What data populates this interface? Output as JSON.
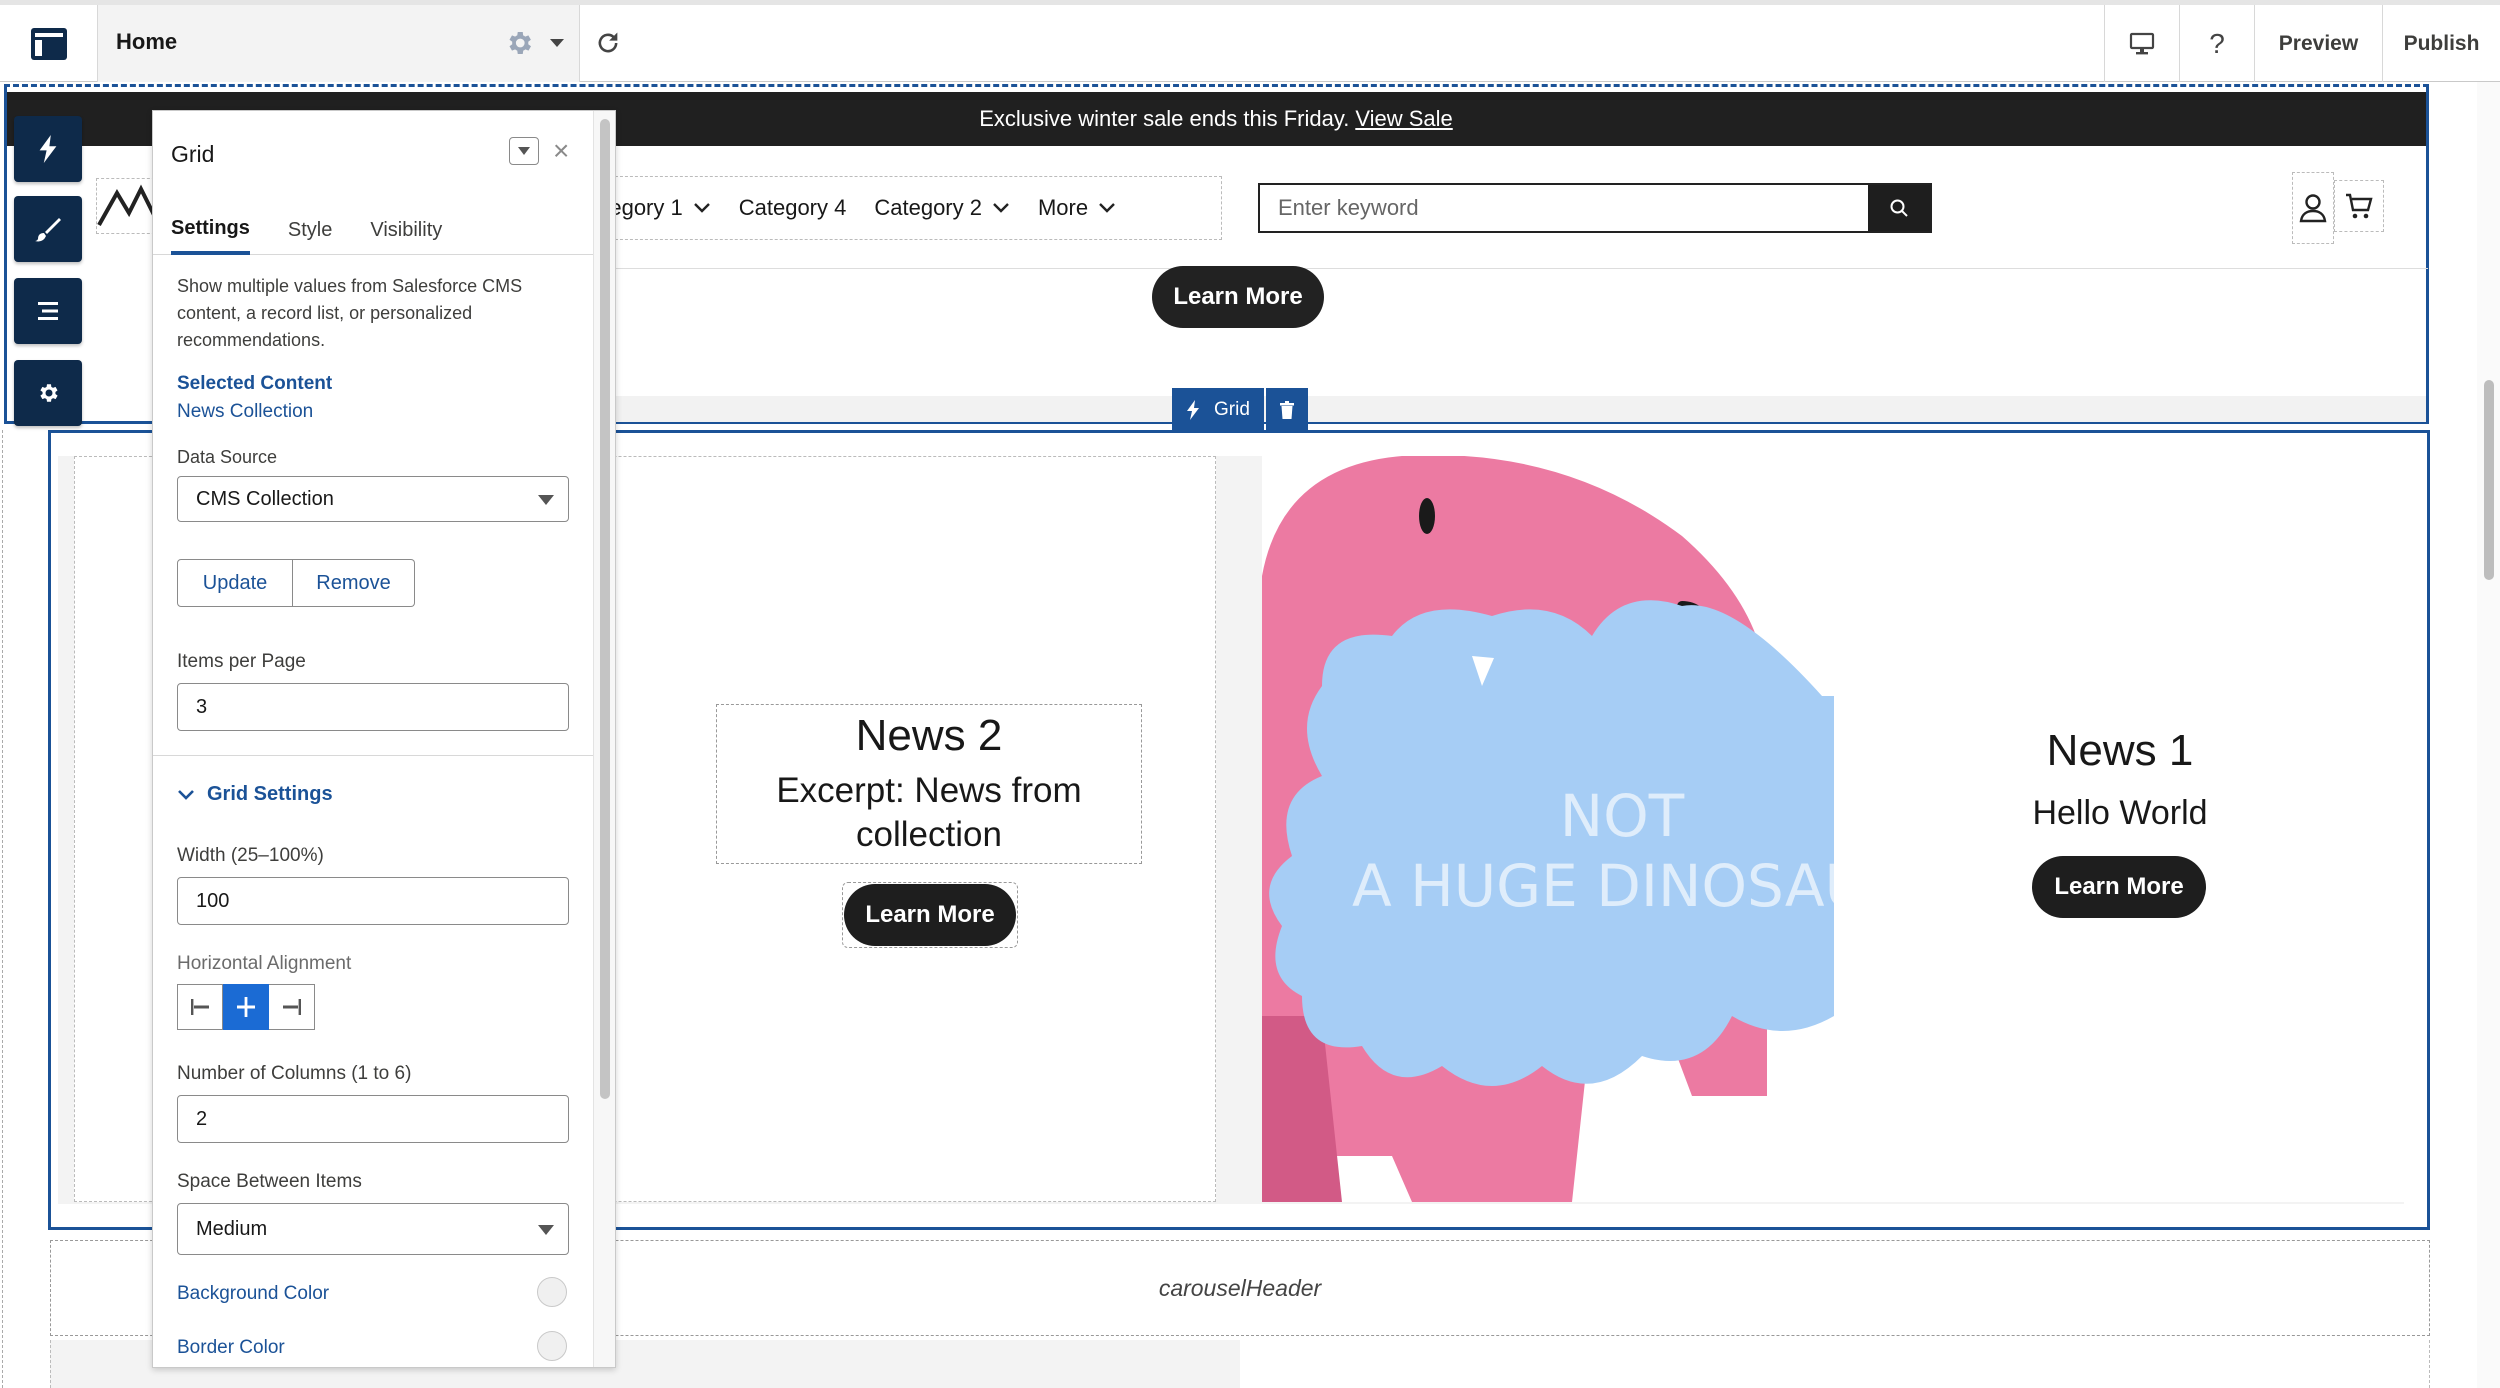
{
  "topbar": {
    "page_name": "Home",
    "preview_label": "Preview",
    "publish_label": "Publish",
    "help_label": "?"
  },
  "site": {
    "announcement_text": "Exclusive winter sale ends this Friday.",
    "announcement_link": "View Sale",
    "nav_items": [
      {
        "label": "ategory 1",
        "has_chevron": true
      },
      {
        "label": "Category 4",
        "has_chevron": false
      },
      {
        "label": "Category 2",
        "has_chevron": true
      },
      {
        "label": "More",
        "has_chevron": true
      }
    ],
    "search_placeholder": "Enter keyword",
    "header_learn_more": "Learn More",
    "grid_chip_label": "Grid",
    "news2": {
      "title": "News 2",
      "excerpt": "Excerpt: News from collection",
      "button": "Learn More"
    },
    "news1": {
      "title": "News 1",
      "excerpt": "Hello World",
      "button": "Learn More",
      "image_text_line1": "NOT",
      "image_text_line2": "A HUGE DINOSAU"
    },
    "carousel_header": "carouselHeader"
  },
  "panel": {
    "title": "Grid",
    "tabs": [
      "Settings",
      "Style",
      "Visibility"
    ],
    "active_tab": "Settings",
    "description": "Show multiple values from Salesforce CMS content, a record list, or personalized recommendations.",
    "selected_content_label": "Selected Content",
    "selected_content_value": "News Collection",
    "data_source_label": "Data Source",
    "data_source_value": "CMS Collection",
    "update_label": "Update",
    "remove_label": "Remove",
    "items_per_page_label": "Items per Page",
    "items_per_page_value": "3",
    "grid_settings_label": "Grid Settings",
    "width_label": "Width (25–100%)",
    "width_value": "100",
    "horizontal_alignment_label": "Horizontal Alignment",
    "horizontal_alignment_selected": "center",
    "columns_label": "Number of Columns (1 to 6)",
    "columns_value": "2",
    "space_label": "Space Between Items",
    "space_value": "Medium",
    "background_color_label": "Background Color",
    "border_color_label": "Border Color"
  },
  "colors": {
    "brand_navy": "#0e2a4a",
    "selection_blue": "#1b5297",
    "active_blue": "#1b6bd4",
    "dino_pink": "#ec7aa2",
    "dino_cloud": "#a6cdf5"
  }
}
